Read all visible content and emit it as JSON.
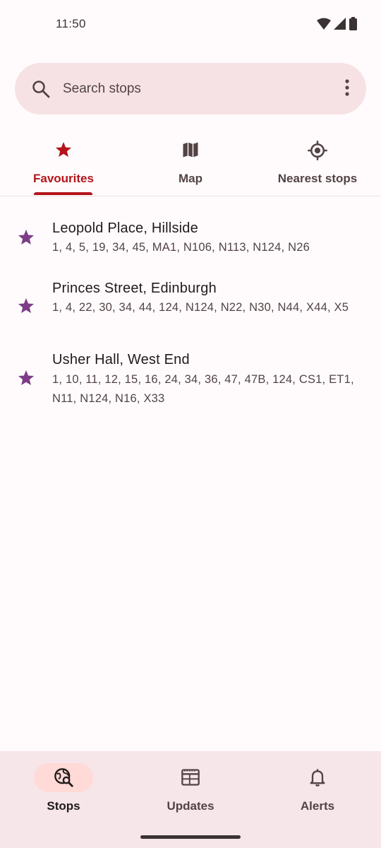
{
  "status_bar": {
    "time": "11:50"
  },
  "search": {
    "placeholder": "Search stops"
  },
  "tabs": [
    {
      "label": "Favourites",
      "icon": "star-icon",
      "active": true
    },
    {
      "label": "Map",
      "icon": "map-icon",
      "active": false
    },
    {
      "label": "Nearest stops",
      "icon": "location-target-icon",
      "active": false
    }
  ],
  "stops": [
    {
      "name": "Leopold Place, Hillside",
      "services": "1, 4, 5, 19, 34, 45, MA1, N106, N113, N124, N26"
    },
    {
      "name": "Princes Street, Edinburgh",
      "services": "1, 4, 22, 30, 34, 44, 124, N124, N22, N30, N44, X44, X5"
    },
    {
      "name": "Usher Hall, West End",
      "services": "1, 10, 11, 12, 15, 16, 24, 34, 36, 47, 47B, 124, CS1, ET1, N11, N124, N16, X33"
    }
  ],
  "bottom_nav": [
    {
      "label": "Stops",
      "icon": "stops-search-icon",
      "active": true
    },
    {
      "label": "Updates",
      "icon": "newspaper-icon",
      "active": false
    },
    {
      "label": "Alerts",
      "icon": "bell-icon",
      "active": false
    }
  ],
  "colors": {
    "accent": "#b3141b",
    "favourite_star": "#7d3d86",
    "surface": "#fffbfc",
    "search_bg": "#f6e2e5",
    "nav_bg": "#f6e6e9",
    "nav_pill": "#ffdad6"
  }
}
